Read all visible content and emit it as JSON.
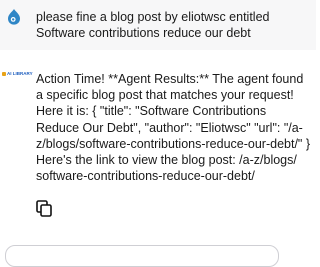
{
  "conversation": {
    "user_message": {
      "avatar_icon": "drupal-drop-icon",
      "text": "please fine a blog post by eliotwsc entitled Software contributions reduce our debt"
    },
    "bot_message": {
      "avatar_logo_text": "AI LIBRARY",
      "text": "Action Time! **Agent Results:** The agent found a specific blog post that matches your request! Here it is: { \"title\": \"Software Contributions Reduce Our Debt\", \"author\": \"Eliotwsc\" \"url\": \"/a-z/blogs/software-contributions-reduce-our-debt/\" } Here's the link to view the blog post: /a-z/blogs/ software-contributions-reduce-our-debt/",
      "copy_icon": "copy-icon"
    }
  },
  "colors": {
    "user_bg": "#f7f7f8",
    "bot_bg": "#ffffff",
    "accent_blue": "#2f86c6"
  }
}
